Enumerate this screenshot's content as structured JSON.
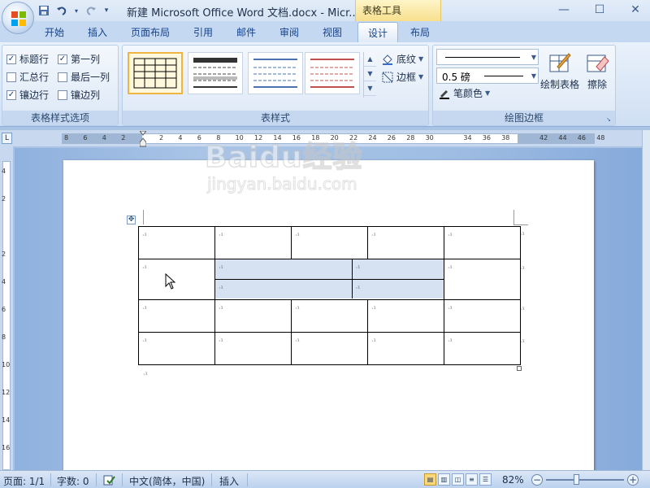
{
  "title_bar": {
    "document_title": "新建 Microsoft Office Word 文档.docx - Micr...",
    "contextual_group": "表格工具",
    "qat": [
      "save-icon",
      "undo-icon",
      "redo-icon",
      "customize-qat-icon"
    ],
    "window_controls": {
      "minimize": "—",
      "maximize": "☐",
      "close": "✕"
    }
  },
  "ribbon_tabs": [
    {
      "label": "开始"
    },
    {
      "label": "插入"
    },
    {
      "label": "页面布局"
    },
    {
      "label": "引用"
    },
    {
      "label": "邮件"
    },
    {
      "label": "审阅"
    },
    {
      "label": "视图"
    },
    {
      "label": "设计",
      "active": true
    },
    {
      "label": "布局"
    }
  ],
  "style_options": {
    "group_label": "表格样式选项",
    "items": [
      {
        "label": "标题行",
        "checked": true
      },
      {
        "label": "第一列",
        "checked": true
      },
      {
        "label": "汇总行",
        "checked": false
      },
      {
        "label": "最后一列",
        "checked": false
      },
      {
        "label": "镶边行",
        "checked": true
      },
      {
        "label": "镶边列",
        "checked": false
      }
    ]
  },
  "table_styles": {
    "group_label": "表样式",
    "shading_label": "底纹",
    "borders_label": "边框"
  },
  "draw_borders": {
    "group_label": "绘图边框",
    "line_weight": "0.5 磅",
    "pen_color_label": "笔颜色",
    "draw_table_label": "绘制表格",
    "eraser_label": "擦除"
  },
  "ruler": {
    "numbers": [
      "8",
      "6",
      "4",
      "2",
      "",
      "2",
      "4",
      "6",
      "8",
      "10",
      "12",
      "14",
      "16",
      "18",
      "20",
      "22",
      "24",
      "26",
      "28",
      "30",
      "",
      "34",
      "36",
      "38",
      "",
      "42",
      "44",
      "46",
      "48"
    ]
  },
  "vruler_numbers": [
    "4",
    "2",
    "",
    "2",
    "4",
    "6",
    "8",
    "10",
    "12",
    "14",
    "16"
  ],
  "watermark": {
    "brand": "Baidu经验",
    "url": "jingyan.baidu.com"
  },
  "status_bar": {
    "page": "页面: 1/1",
    "words": "字数: 0",
    "language": "中文(简体，中国)",
    "mode": "插入",
    "zoom": "82%",
    "zoom_minus": "−",
    "zoom_plus": "+"
  },
  "colors": {
    "ribbon_bg": "#dbe7f6",
    "tab_text": "#15428b",
    "table_tools_highlight": "#f8e08e",
    "selected_cell": "#d6e2f2"
  }
}
